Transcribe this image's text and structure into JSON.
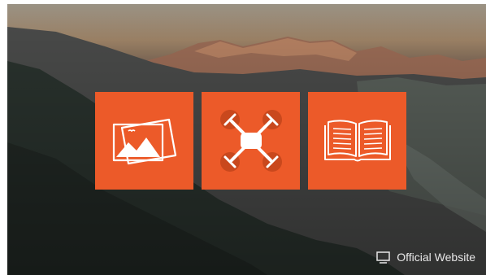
{
  "app": {
    "tiles": [
      {
        "name": "gallery-tile",
        "icon": "gallery-icon"
      },
      {
        "name": "drone-tile",
        "icon": "drone-icon"
      },
      {
        "name": "manual-tile",
        "icon": "book-icon"
      }
    ],
    "official_website": {
      "label": "Official Website",
      "icon": "monitor-icon"
    },
    "colors": {
      "tile": "#ec5a29",
      "text": "#e8e8e8"
    }
  }
}
